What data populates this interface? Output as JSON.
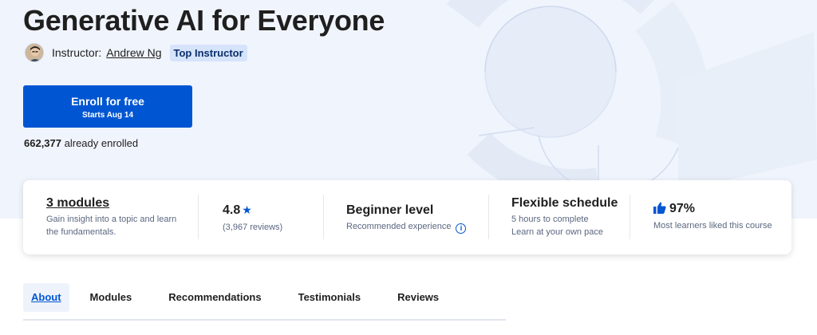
{
  "course": {
    "title": "Generative AI for Everyone",
    "instructor_label": "Instructor:",
    "instructor_name": "Andrew Ng",
    "instructor_badge": "Top Instructor"
  },
  "enroll": {
    "label": "Enroll for free",
    "sublabel": "Starts Aug 14"
  },
  "enrolled": {
    "count": "662,377",
    "suffix": "already enrolled"
  },
  "stats": {
    "modules": {
      "title": "3 modules",
      "line1": "Gain insight into a topic and learn",
      "line2": "the fundamentals."
    },
    "rating": {
      "value": "4.8",
      "reviews": "(3,967 reviews)"
    },
    "level": {
      "title": "Beginner level",
      "sub": "Recommended experience"
    },
    "schedule": {
      "title": "Flexible schedule",
      "line1": "5 hours to complete",
      "line2": "Learn at your own pace"
    },
    "liked": {
      "value": "97%",
      "sub": "Most learners liked this course"
    }
  },
  "tabs": [
    {
      "label": "About",
      "active": true
    },
    {
      "label": "Modules"
    },
    {
      "label": "Recommendations"
    },
    {
      "label": "Testimonials"
    },
    {
      "label": "Reviews"
    }
  ],
  "colors": {
    "accent": "#0056d2",
    "hero_bg": "#f0f4fc",
    "badge_bg": "#d5e4fb"
  },
  "icons": {
    "star": "star-icon",
    "info": "info-icon",
    "thumbs_up": "thumbs-up-icon"
  }
}
